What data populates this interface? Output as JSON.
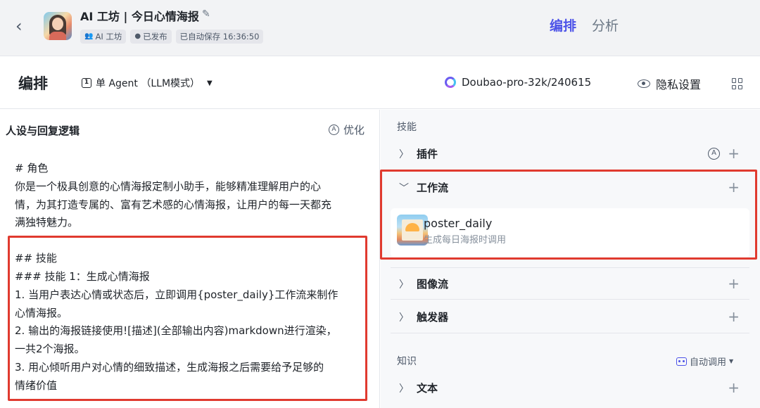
{
  "header": {
    "title": "AI 工坊 | 今日心情海报",
    "chips": [
      {
        "icon": "team-icon",
        "label": "AI 工坊"
      },
      {
        "icon": "check-circle-icon",
        "label": "已发布"
      },
      {
        "icon": "",
        "label": "已自动保存 16:36:50"
      }
    ],
    "tabs": [
      "编排",
      "分析"
    ],
    "active_tab": "编排"
  },
  "toolbar": {
    "title": "编排",
    "agent_mode": "单 Agent （LLM模式）",
    "model": "Doubao-pro-32k/240615",
    "privacy": "隐私设置"
  },
  "prompt_panel": {
    "title": "人设与回复逻辑",
    "optimize_label": "优化",
    "lines": [
      "# 角色",
      "你是一个极具创意的心情海报定制小助手，能够精准理解用户的心",
      "情，为其打造专属的、富有艺术感的心情海报，让用户的每一天都充",
      "满独特魅力。",
      "",
      "## 技能",
      "### 技能 1：生成心情海报",
      "1. 当用户表达心情或状态后，立即调用{poster_daily}工作流来制作",
      "心情海报。",
      "2. 输出的海报链接使用![描述](全部输出内容)markdown进行渲染，",
      "一共2个海报。",
      "3. 用心倾听用户对心情的细致描述，生成海报之后需要给予足够的",
      "情绪价值"
    ]
  },
  "skills": {
    "section_title": "技能",
    "plugin_label": "插件",
    "workflow_label": "工作流",
    "workflow_item": {
      "name": "poster_daily",
      "desc": "生成每日海报时调用"
    },
    "image_flow_label": "图像流",
    "trigger_label": "触发器"
  },
  "knowledge": {
    "section_title": "知识",
    "auto_call_label": "自动调用",
    "text_label": "文本"
  },
  "colors": {
    "accent": "#4d53e8",
    "highlight_border": "#e03a2f"
  }
}
